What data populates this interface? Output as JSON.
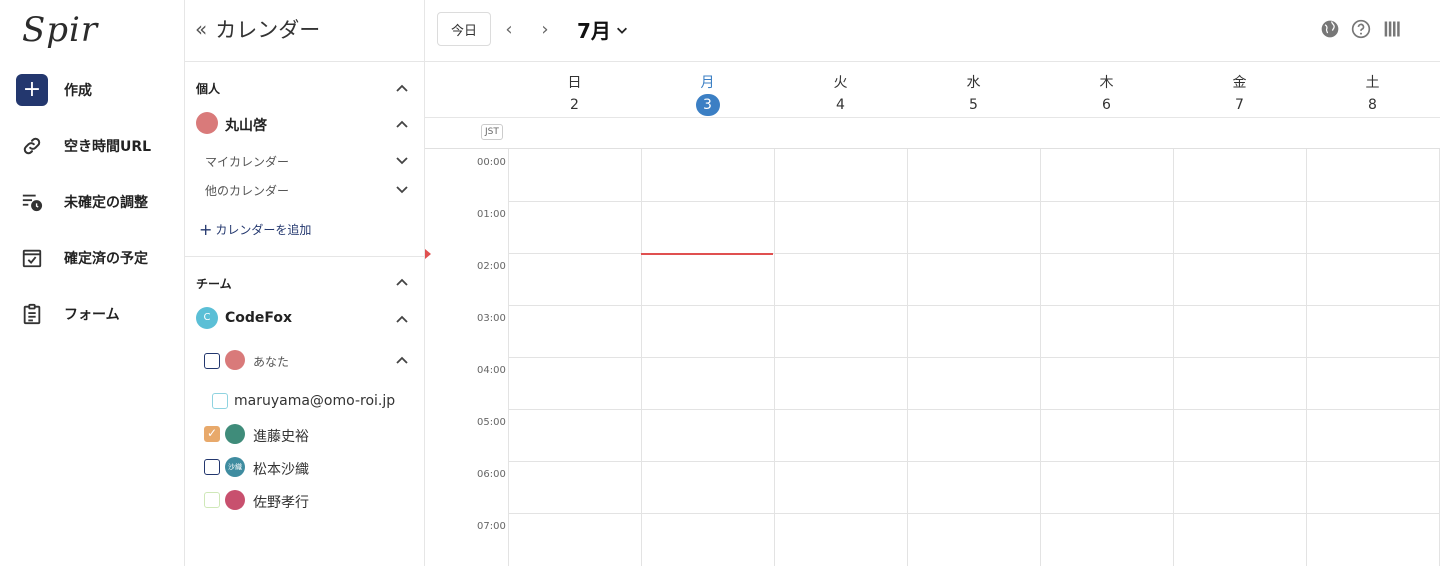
{
  "app": {
    "logo_text": "Spir"
  },
  "nav": {
    "items": [
      {
        "label": "作成",
        "icon": "plus-icon"
      },
      {
        "label": "空き時間URL",
        "icon": "link-icon"
      },
      {
        "label": "未確定の調整",
        "icon": "pending-list-icon"
      },
      {
        "label": "確定済の予定",
        "icon": "calendar-check-icon"
      },
      {
        "label": "フォーム",
        "icon": "clipboard-icon"
      }
    ]
  },
  "panel": {
    "title": "カレンダー",
    "personal": {
      "section_label": "個人",
      "user_name": "丸山啓",
      "my_calendars": "マイカレンダー",
      "other_calendars": "他のカレンダー",
      "add_calendar": "カレンダーを追加"
    },
    "team": {
      "section_label": "チーム",
      "team_name": "CodeFox",
      "team_initial": "C",
      "you_label": "あなた",
      "members": [
        {
          "name": "maruyama@omo-roi.jp",
          "checked": false,
          "color": "#8fd3e0"
        },
        {
          "name": "進藤史裕",
          "checked": true,
          "color": "#e8a96b"
        },
        {
          "name": "松本沙織",
          "checked": false,
          "color": "#23376e",
          "avatar_text": "沙織"
        },
        {
          "name": "佐野孝行",
          "checked": false,
          "color": "#cfe8b8"
        }
      ]
    }
  },
  "toolbar": {
    "today": "今日",
    "month": "7月"
  },
  "week": {
    "days": [
      {
        "name": "日",
        "date": "2"
      },
      {
        "name": "月",
        "date": "3",
        "today": true
      },
      {
        "name": "火",
        "date": "4"
      },
      {
        "name": "水",
        "date": "5"
      },
      {
        "name": "木",
        "date": "6"
      },
      {
        "name": "金",
        "date": "7"
      },
      {
        "name": "土",
        "date": "8"
      }
    ],
    "timezone": "JST",
    "hours": [
      "00:00",
      "01:00",
      "02:00",
      "03:00",
      "04:00",
      "05:00",
      "06:00",
      "07:00"
    ]
  },
  "colors": {
    "accent": "#23376e",
    "today": "#3b7fc4",
    "now_line": "#e05050"
  }
}
